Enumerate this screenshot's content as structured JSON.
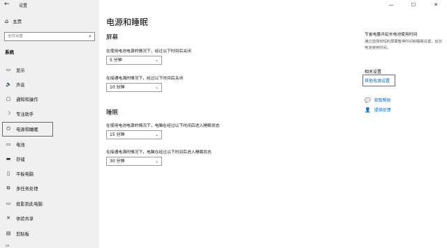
{
  "window": {
    "title": "设置",
    "back": "←",
    "minimize": "—",
    "maximize": "☐",
    "close": "✕"
  },
  "sidebar": {
    "home": "主页",
    "search_placeholder": "查找设置",
    "section": "系统",
    "items": [
      {
        "label": "显示",
        "icon": "display-icon",
        "glyph": "▭"
      },
      {
        "label": "声音",
        "icon": "sound-icon",
        "glyph": "🔈"
      },
      {
        "label": "通知和操作",
        "icon": "notification-icon",
        "glyph": "▢"
      },
      {
        "label": "专注助手",
        "icon": "focus-assist-icon",
        "glyph": "☽"
      },
      {
        "label": "电源和睡眠",
        "icon": "power-icon",
        "glyph": "⏻"
      },
      {
        "label": "电池",
        "icon": "battery-icon",
        "glyph": "▭"
      },
      {
        "label": "存储",
        "icon": "storage-icon",
        "glyph": "▬"
      },
      {
        "label": "平板电脑",
        "icon": "tablet-icon",
        "glyph": "▯"
      },
      {
        "label": "多任务处理",
        "icon": "multitask-icon",
        "glyph": "⧉"
      },
      {
        "label": "投影到此电脑",
        "icon": "project-icon",
        "glyph": "▭"
      },
      {
        "label": "体验共享",
        "icon": "share-icon",
        "glyph": "✕"
      },
      {
        "label": "剪贴板",
        "icon": "clipboard-icon",
        "glyph": "▤"
      }
    ]
  },
  "main": {
    "title": "电源和睡眠",
    "screen": {
      "heading": "屏幕",
      "battery_label": "在使用电池电源的情况下，经过以下时间后关闭",
      "battery_value": "5 分钟",
      "plugged_label": "在接通电源的情况下，经过以下时间后关闭",
      "plugged_value": "10 分钟"
    },
    "sleep": {
      "heading": "睡眠",
      "battery_label": "在使用电池电源的情况下，电脑在经过以下时间后进入睡眠状态",
      "battery_value": "15 分钟",
      "plugged_label": "在接通电源的情况下，电脑在经过以下时间后进入睡眠状态",
      "plugged_value": "30 分钟"
    }
  },
  "right": {
    "tip_title": "节省电量并延长电池使用时间",
    "tip_desc": "通过选择较短的屏幕暂停时间和睡眠设置，延长电池使用时间。",
    "related_heading": "相关设置",
    "other_power": "其他电源设置",
    "get_help": "获取帮助",
    "feedback": "提供反馈"
  },
  "colors": {
    "accent": "#0067c0",
    "highlight": "#d23c3c",
    "sidebar": "#f0f0f0"
  }
}
